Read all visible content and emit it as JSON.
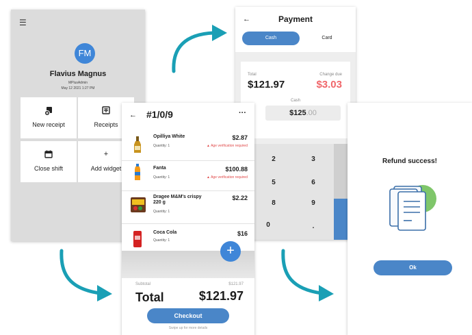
{
  "colors": {
    "accent": "#4a86c8",
    "teal_arrow": "#1a9fb5",
    "warning": "#e04848",
    "change_due": "#f0666a",
    "home_bg": "#dcdcdc"
  },
  "home": {
    "menu_icon": "hamburger-menu-icon",
    "avatar_initials": "FM",
    "user_name": "Flavius Magnus",
    "user_role": "MPlusAdmin",
    "date": "May 12 2021 1:27 PM",
    "tiles": [
      {
        "label": "New receipt",
        "icon": "new-receipt-icon"
      },
      {
        "label": "Receipts",
        "icon": "receipts-icon"
      },
      {
        "label": "Close shift",
        "icon": "calendar-icon"
      },
      {
        "label": "Add widget",
        "icon": "plus-icon"
      }
    ]
  },
  "payment": {
    "title": "Payment",
    "tabs": {
      "cash": "Cash",
      "card": "Card"
    },
    "total_label": "Total",
    "total_value": "$121.97",
    "change_label": "Change due",
    "change_value": "$3.03",
    "cash_label": "Cash",
    "cash_value_main": "$125",
    "cash_value_decimals": ".00",
    "keys": [
      "2",
      "3",
      "5",
      "6",
      "8",
      "9",
      "0",
      "."
    ]
  },
  "receipt": {
    "number": "#1/0/9",
    "more": "···",
    "items": [
      {
        "name": "Opilliya White",
        "qty": "Quantity: 1",
        "price": "$2.87",
        "warning": "Age verification required"
      },
      {
        "name": "Fanta",
        "qty": "Quantity: 1",
        "price": "$100.88",
        "warning": "Age verification required"
      },
      {
        "name": "Dragee M&M's crispy 220 g",
        "qty": "Quantity: 1",
        "price": "$2.22",
        "warning": ""
      },
      {
        "name": "Coca Cola",
        "qty": "Quantity: 1",
        "price": "$16",
        "warning": ""
      }
    ],
    "subtotal_label": "Subtotal",
    "subtotal_value": "$121.97",
    "total_label": "Total",
    "total_value": "$121.97",
    "checkout_label": "Checkout",
    "swipe_hint": "Swipe up for more details"
  },
  "refund": {
    "message": "Refund success!",
    "ok_label": "Ok"
  }
}
